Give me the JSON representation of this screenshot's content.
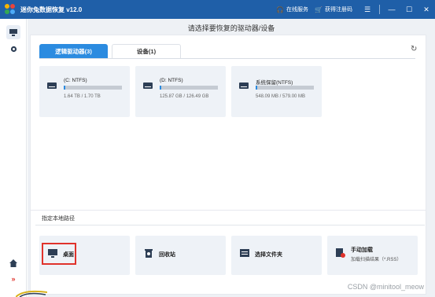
{
  "app": {
    "title": "迷你兔数据恢复 v12.0",
    "online_service": "在线服务",
    "get_code": "获得注册码"
  },
  "main": {
    "heading": "请选择要恢复的驱动器/设备",
    "tabs": [
      {
        "label": "逻辑驱动器(3)",
        "active": true
      },
      {
        "label": "设备(1)",
        "active": false
      }
    ],
    "drives": [
      {
        "name": "(C: NTFS)",
        "size": "1.64 TB / 1.70 TB",
        "used_fraction": 0.03
      },
      {
        "name": "(D: NTFS)",
        "size": "125.87 GB / 126.49 GB",
        "used_fraction": 0.03
      },
      {
        "name": "系统保留(NTFS)",
        "size": "548.09 MB / 579.00 MB",
        "used_fraction": 0.03
      }
    ],
    "specify_path_title": "指定本地路径",
    "locations": [
      {
        "label": "桌面",
        "sub": ""
      },
      {
        "label": "回收站",
        "sub": ""
      },
      {
        "label": "选择文件夹",
        "sub": ""
      },
      {
        "label": "手动加载",
        "sub": "加载扫描结果（*.RSS）"
      }
    ]
  },
  "watermark": "CSDN @minitool_meow",
  "colors": {
    "titlebar": "#1f5fa8",
    "accent": "#2b8be0",
    "highlight": "#e0322b"
  }
}
